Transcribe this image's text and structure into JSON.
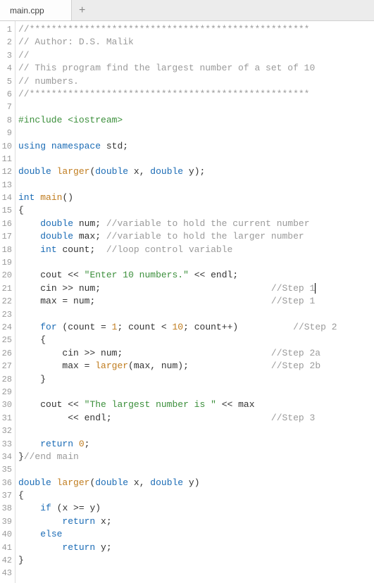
{
  "tab": {
    "filename": "main.cpp",
    "add_icon": "+"
  },
  "editor": {
    "line_count": 43,
    "lines": [
      {
        "n": 1,
        "tokens": [
          [
            "cm",
            "//***************************************************"
          ]
        ]
      },
      {
        "n": 2,
        "tokens": [
          [
            "cm",
            "// Author: D.S. Malik"
          ]
        ]
      },
      {
        "n": 3,
        "tokens": [
          [
            "cm",
            "//"
          ]
        ]
      },
      {
        "n": 4,
        "tokens": [
          [
            "cm",
            "// This program find the largest number of a set of 10"
          ]
        ]
      },
      {
        "n": 5,
        "tokens": [
          [
            "cm",
            "// numbers."
          ]
        ]
      },
      {
        "n": 6,
        "tokens": [
          [
            "cm",
            "//***************************************************"
          ]
        ]
      },
      {
        "n": 7,
        "tokens": []
      },
      {
        "n": 8,
        "tokens": [
          [
            "pp",
            "#include <iostream>"
          ]
        ]
      },
      {
        "n": 9,
        "tokens": []
      },
      {
        "n": 10,
        "tokens": [
          [
            "kw",
            "using"
          ],
          [
            "pu",
            " "
          ],
          [
            "kw",
            "namespace"
          ],
          [
            "pu",
            " "
          ],
          [
            "id",
            "std"
          ],
          [
            "pu",
            ";"
          ]
        ]
      },
      {
        "n": 11,
        "tokens": []
      },
      {
        "n": 12,
        "tokens": [
          [
            "ty",
            "double"
          ],
          [
            "pu",
            " "
          ],
          [
            "fn",
            "larger"
          ],
          [
            "pu",
            "("
          ],
          [
            "ty",
            "double"
          ],
          [
            "pu",
            " "
          ],
          [
            "id",
            "x"
          ],
          [
            "pu",
            ", "
          ],
          [
            "ty",
            "double"
          ],
          [
            "pu",
            " "
          ],
          [
            "id",
            "y"
          ],
          [
            "pu",
            ");"
          ]
        ]
      },
      {
        "n": 13,
        "tokens": []
      },
      {
        "n": 14,
        "tokens": [
          [
            "ty",
            "int"
          ],
          [
            "pu",
            " "
          ],
          [
            "fn",
            "main"
          ],
          [
            "pu",
            "()"
          ]
        ]
      },
      {
        "n": 15,
        "tokens": [
          [
            "pu",
            "{"
          ]
        ]
      },
      {
        "n": 16,
        "tokens": [
          [
            "pu",
            "    "
          ],
          [
            "ty",
            "double"
          ],
          [
            "pu",
            " "
          ],
          [
            "id",
            "num"
          ],
          [
            "pu",
            "; "
          ],
          [
            "cm",
            "//variable to hold the current number"
          ]
        ]
      },
      {
        "n": 17,
        "tokens": [
          [
            "pu",
            "    "
          ],
          [
            "ty",
            "double"
          ],
          [
            "pu",
            " "
          ],
          [
            "id",
            "max"
          ],
          [
            "pu",
            "; "
          ],
          [
            "cm",
            "//variable to hold the larger number"
          ]
        ]
      },
      {
        "n": 18,
        "tokens": [
          [
            "pu",
            "    "
          ],
          [
            "ty",
            "int"
          ],
          [
            "pu",
            " "
          ],
          [
            "id",
            "count"
          ],
          [
            "pu",
            ";  "
          ],
          [
            "cm",
            "//loop control variable"
          ]
        ]
      },
      {
        "n": 19,
        "tokens": []
      },
      {
        "n": 20,
        "tokens": [
          [
            "pu",
            "    "
          ],
          [
            "id",
            "cout"
          ],
          [
            "pu",
            " << "
          ],
          [
            "st",
            "\"Enter 10 numbers.\""
          ],
          [
            "pu",
            " << "
          ],
          [
            "id",
            "endl"
          ],
          [
            "pu",
            ";"
          ]
        ]
      },
      {
        "n": 21,
        "tokens": [
          [
            "pu",
            "    "
          ],
          [
            "id",
            "cin"
          ],
          [
            "pu",
            " >> "
          ],
          [
            "id",
            "num"
          ],
          [
            "pu",
            ";                               "
          ],
          [
            "cm",
            "//Step 1"
          ]
        ],
        "cursor": true
      },
      {
        "n": 22,
        "tokens": [
          [
            "pu",
            "    "
          ],
          [
            "id",
            "max"
          ],
          [
            "pu",
            " = "
          ],
          [
            "id",
            "num"
          ],
          [
            "pu",
            ";                                "
          ],
          [
            "cm",
            "//Step 1"
          ]
        ]
      },
      {
        "n": 23,
        "tokens": []
      },
      {
        "n": 24,
        "tokens": [
          [
            "pu",
            "    "
          ],
          [
            "kw",
            "for"
          ],
          [
            "pu",
            " ("
          ],
          [
            "id",
            "count"
          ],
          [
            "pu",
            " = "
          ],
          [
            "nu",
            "1"
          ],
          [
            "pu",
            "; "
          ],
          [
            "id",
            "count"
          ],
          [
            "pu",
            " < "
          ],
          [
            "nu",
            "10"
          ],
          [
            "pu",
            "; "
          ],
          [
            "id",
            "count"
          ],
          [
            "pu",
            "++)          "
          ],
          [
            "cm",
            "//Step 2"
          ]
        ]
      },
      {
        "n": 25,
        "tokens": [
          [
            "pu",
            "    {"
          ]
        ]
      },
      {
        "n": 26,
        "tokens": [
          [
            "pu",
            "        "
          ],
          [
            "id",
            "cin"
          ],
          [
            "pu",
            " >> "
          ],
          [
            "id",
            "num"
          ],
          [
            "pu",
            ";                           "
          ],
          [
            "cm",
            "//Step 2a"
          ]
        ]
      },
      {
        "n": 27,
        "tokens": [
          [
            "pu",
            "        "
          ],
          [
            "id",
            "max"
          ],
          [
            "pu",
            " = "
          ],
          [
            "fn",
            "larger"
          ],
          [
            "pu",
            "("
          ],
          [
            "id",
            "max"
          ],
          [
            "pu",
            ", "
          ],
          [
            "id",
            "num"
          ],
          [
            "pu",
            ");               "
          ],
          [
            "cm",
            "//Step 2b"
          ]
        ]
      },
      {
        "n": 28,
        "tokens": [
          [
            "pu",
            "    }"
          ]
        ]
      },
      {
        "n": 29,
        "tokens": []
      },
      {
        "n": 30,
        "tokens": [
          [
            "pu",
            "    "
          ],
          [
            "id",
            "cout"
          ],
          [
            "pu",
            " << "
          ],
          [
            "st",
            "\"The largest number is \""
          ],
          [
            "pu",
            " << "
          ],
          [
            "id",
            "max"
          ]
        ]
      },
      {
        "n": 31,
        "tokens": [
          [
            "pu",
            "         << "
          ],
          [
            "id",
            "endl"
          ],
          [
            "pu",
            ";                             "
          ],
          [
            "cm",
            "//Step 3"
          ]
        ]
      },
      {
        "n": 32,
        "tokens": []
      },
      {
        "n": 33,
        "tokens": [
          [
            "pu",
            "    "
          ],
          [
            "kw",
            "return"
          ],
          [
            "pu",
            " "
          ],
          [
            "nu",
            "0"
          ],
          [
            "pu",
            ";"
          ]
        ]
      },
      {
        "n": 34,
        "tokens": [
          [
            "pu",
            "}"
          ],
          [
            "cm",
            "//end main"
          ]
        ]
      },
      {
        "n": 35,
        "tokens": []
      },
      {
        "n": 36,
        "tokens": [
          [
            "ty",
            "double"
          ],
          [
            "pu",
            " "
          ],
          [
            "fn",
            "larger"
          ],
          [
            "pu",
            "("
          ],
          [
            "ty",
            "double"
          ],
          [
            "pu",
            " "
          ],
          [
            "id",
            "x"
          ],
          [
            "pu",
            ", "
          ],
          [
            "ty",
            "double"
          ],
          [
            "pu",
            " "
          ],
          [
            "id",
            "y"
          ],
          [
            "pu",
            ")"
          ]
        ]
      },
      {
        "n": 37,
        "tokens": [
          [
            "pu",
            "{"
          ]
        ]
      },
      {
        "n": 38,
        "tokens": [
          [
            "pu",
            "    "
          ],
          [
            "kw",
            "if"
          ],
          [
            "pu",
            " ("
          ],
          [
            "id",
            "x"
          ],
          [
            "pu",
            " >= "
          ],
          [
            "id",
            "y"
          ],
          [
            "pu",
            ")"
          ]
        ]
      },
      {
        "n": 39,
        "tokens": [
          [
            "pu",
            "        "
          ],
          [
            "kw",
            "return"
          ],
          [
            "pu",
            " "
          ],
          [
            "id",
            "x"
          ],
          [
            "pu",
            ";"
          ]
        ]
      },
      {
        "n": 40,
        "tokens": [
          [
            "pu",
            "    "
          ],
          [
            "kw",
            "else"
          ]
        ]
      },
      {
        "n": 41,
        "tokens": [
          [
            "pu",
            "        "
          ],
          [
            "kw",
            "return"
          ],
          [
            "pu",
            " "
          ],
          [
            "id",
            "y"
          ],
          [
            "pu",
            ";"
          ]
        ]
      },
      {
        "n": 42,
        "tokens": [
          [
            "pu",
            "}"
          ]
        ]
      },
      {
        "n": 43,
        "tokens": []
      }
    ]
  }
}
